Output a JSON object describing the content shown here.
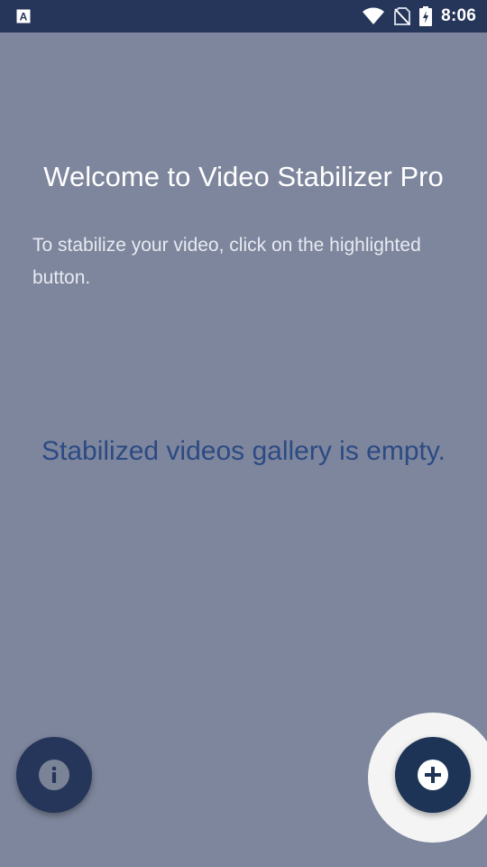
{
  "status_bar": {
    "time": "8:06",
    "icons": [
      "accessibility-app-icon",
      "wifi-icon",
      "no-sim-icon",
      "battery-charging-icon"
    ]
  },
  "welcome": {
    "title": "Welcome to Video Stabilizer Pro",
    "description": "To stabilize your video, click on the highlighted button."
  },
  "gallery": {
    "empty_message": "Stabilized videos gallery is empty."
  },
  "buttons": {
    "info_icon": "info-icon",
    "add_icon": "plus-circle-icon"
  },
  "colors": {
    "status_bar": "#26365a",
    "overlay_background": "#7d869c",
    "empty_text": "#2c4a84",
    "button": "#1d3456",
    "highlight": "#f4f4f4"
  }
}
